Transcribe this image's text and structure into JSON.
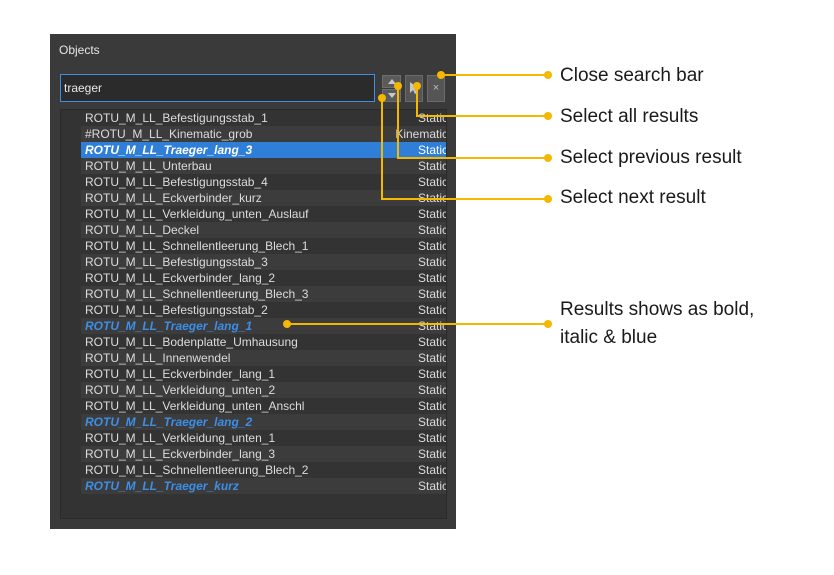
{
  "panel": {
    "title": "Objects",
    "search": {
      "value": "traeger",
      "placeholder": ""
    },
    "buttons": {
      "prev_icon": "chevron-up-icon",
      "next_icon": "chevron-down-icon",
      "select_all_icon": "cursor-arrow-icon",
      "close_label": "×"
    }
  },
  "rows": [
    {
      "name": "ROTU_M_LL_Befestigungsstab_1",
      "type": "Static",
      "state": "normal"
    },
    {
      "name": "#ROTU_M_LL_Kinematic_grob",
      "type": "Kinematic",
      "state": "normal"
    },
    {
      "name": "ROTU_M_LL_Traeger_lang_3",
      "type": "Static",
      "state": "selected"
    },
    {
      "name": "ROTU_M_LL_Unterbau",
      "type": "Static",
      "state": "normal"
    },
    {
      "name": "ROTU_M_LL_Befestigungsstab_4",
      "type": "Static",
      "state": "normal"
    },
    {
      "name": "ROTU_M_LL_Eckverbinder_kurz",
      "type": "Static",
      "state": "normal"
    },
    {
      "name": "ROTU_M_LL_Verkleidung_unten_Auslauf",
      "type": "Static",
      "state": "normal"
    },
    {
      "name": "ROTU_M_LL_Deckel",
      "type": "Static",
      "state": "normal"
    },
    {
      "name": "ROTU_M_LL_Schnellentleerung_Blech_1",
      "type": "Static",
      "state": "normal"
    },
    {
      "name": "ROTU_M_LL_Befestigungsstab_3",
      "type": "Static",
      "state": "normal"
    },
    {
      "name": "ROTU_M_LL_Eckverbinder_lang_2",
      "type": "Static",
      "state": "normal"
    },
    {
      "name": "ROTU_M_LL_Schnellentleerung_Blech_3",
      "type": "Static",
      "state": "normal"
    },
    {
      "name": "ROTU_M_LL_Befestigungsstab_2",
      "type": "Static",
      "state": "normal"
    },
    {
      "name": "ROTU_M_LL_Traeger_lang_1",
      "type": "Static",
      "state": "result"
    },
    {
      "name": "ROTU_M_LL_Bodenplatte_Umhausung",
      "type": "Static",
      "state": "normal"
    },
    {
      "name": "ROTU_M_LL_Innenwendel",
      "type": "Static",
      "state": "normal"
    },
    {
      "name": "ROTU_M_LL_Eckverbinder_lang_1",
      "type": "Static",
      "state": "normal"
    },
    {
      "name": "ROTU_M_LL_Verkleidung_unten_2",
      "type": "Static",
      "state": "normal"
    },
    {
      "name": "ROTU_M_LL_Verkleidung_unten_Anschl",
      "type": "Static",
      "state": "normal"
    },
    {
      "name": "ROTU_M_LL_Traeger_lang_2",
      "type": "Static",
      "state": "result"
    },
    {
      "name": "ROTU_M_LL_Verkleidung_unten_1",
      "type": "Static",
      "state": "normal"
    },
    {
      "name": "ROTU_M_LL_Eckverbinder_lang_3",
      "type": "Static",
      "state": "normal"
    },
    {
      "name": "ROTU_M_LL_Schnellentleerung_Blech_2",
      "type": "Static",
      "state": "normal"
    },
    {
      "name": "ROTU_M_LL_Traeger_kurz",
      "type": "Static",
      "state": "result"
    }
  ],
  "annotations": {
    "close": "Close search bar",
    "select_all": "Select all results",
    "select_prev": "Select previous result",
    "select_next": "Select next result",
    "results_line1": "Results shows as bold,",
    "results_line2": "italic & blue"
  },
  "colors": {
    "accent": "#3d8ee6",
    "selection": "#2f7fd8",
    "annotation": "#f5b800",
    "panel": "#3a3a3a"
  }
}
